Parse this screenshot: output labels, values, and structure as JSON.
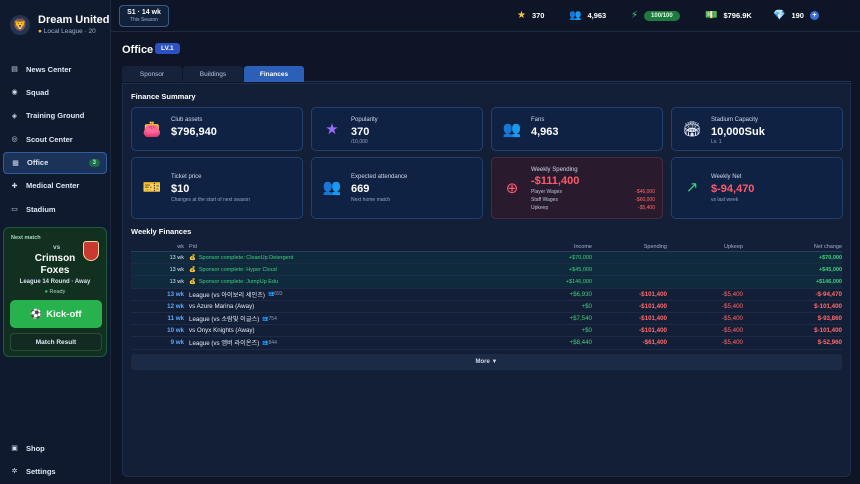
{
  "club": {
    "name": "Dream United",
    "league": "Local League · 20"
  },
  "season": {
    "label": "S1 · 14 wk",
    "sub": "This Season"
  },
  "stats": {
    "stars": "370",
    "fans": "4,963",
    "energy": "100/100",
    "money": "$796.9K",
    "gems": "190"
  },
  "nav": [
    {
      "label": "News Center",
      "icon": "newspaper-icon",
      "glyph": "▤"
    },
    {
      "label": "Squad",
      "icon": "squad-icon",
      "glyph": "◉"
    },
    {
      "label": "Training Ground",
      "icon": "training-icon",
      "glyph": "◈"
    },
    {
      "label": "Scout Center",
      "icon": "scout-icon",
      "glyph": "◎"
    },
    {
      "label": "Office",
      "icon": "office-icon",
      "glyph": "▦",
      "badge": "3"
    },
    {
      "label": "Medical Center",
      "icon": "medical-icon",
      "glyph": "✚"
    },
    {
      "label": "Stadium",
      "icon": "stadium-icon",
      "glyph": "▭"
    }
  ],
  "bottom_nav": [
    {
      "label": "Shop",
      "icon": "shop-icon",
      "glyph": "▣"
    },
    {
      "label": "Settings",
      "icon": "gear-icon",
      "glyph": "✲"
    }
  ],
  "next_match": {
    "label": "Next match",
    "vs": "vs",
    "opponent": "Crimson Foxes",
    "round": "League 14 Round · Away",
    "status": "Ready",
    "kickoff": "Kick-off",
    "result": "Match Result"
  },
  "page": {
    "title": "Office",
    "level": "LV.1"
  },
  "tabs": [
    "Sponsor",
    "Buildings",
    "Finances"
  ],
  "summary": {
    "title": "Finance Summary",
    "club_assets": {
      "label": "Club assets",
      "value": "$796,940"
    },
    "popularity": {
      "label": "Popularity",
      "value": "370",
      "sub": "/10,000"
    },
    "fans": {
      "label": "Fans",
      "value": "4,963"
    },
    "stadium": {
      "label": "Stadium Capacity",
      "value": "10,000Suk",
      "sub": "Lv. 1"
    },
    "ticket": {
      "label": "Ticket price",
      "value": "$10",
      "sub": "Changes at the start of next season"
    },
    "attendance": {
      "label": "Expected attendance",
      "value": "669",
      "sub": "Next home match"
    },
    "spending": {
      "label": "Weekly Spending",
      "value": "-$111,400",
      "rows": [
        {
          "label": "Player Wages",
          "value": "-$46,000"
        },
        {
          "label": "Staff Wages",
          "value": "-$60,000"
        },
        {
          "label": "Upkeep",
          "value": "-$5,400"
        }
      ]
    },
    "net": {
      "label": "Weekly Net",
      "value": "$-94,470",
      "sub": "vs last week"
    }
  },
  "weekly": {
    "title": "Weekly Finances",
    "headers": {
      "wk": "wk",
      "pid": "Pid",
      "income": "Income",
      "spending": "Spending",
      "upkeep": "Upkeep",
      "net": "Net change"
    },
    "rows": [
      {
        "wk": "13 wk",
        "pid": "Sponsor complete: CleanUp Detergent",
        "att": "",
        "income": "+$70,000",
        "spending": "",
        "upkeep": "",
        "net": "+$70,000",
        "type": "sp"
      },
      {
        "wk": "13 wk",
        "pid": "Sponsor complete: Hyper Cloud",
        "att": "",
        "income": "+$45,000",
        "spending": "",
        "upkeep": "",
        "net": "+$45,000",
        "type": "sp"
      },
      {
        "wk": "13 wk",
        "pid": "Sponsor complete: JumpUp Edu",
        "att": "",
        "income": "+$146,000",
        "spending": "",
        "upkeep": "",
        "net": "+$146,000",
        "type": "sp"
      },
      {
        "wk": "13 wk",
        "pid": "League (vs 아이보리 세인츠)",
        "att": "693",
        "income": "+$6,930",
        "spending": "-$101,400",
        "upkeep": "-$5,400",
        "net": "-$-94,470",
        "type": "lg"
      },
      {
        "wk": "12 wk",
        "pid": "vs Azure Marina (Away)",
        "att": "",
        "income": "+$0",
        "spending": "-$101,400",
        "upkeep": "-$5,400",
        "net": "$-101,400",
        "type": "lg"
      },
      {
        "wk": "11 wk",
        "pid": "League (vs 소람빛 이글스)",
        "att": "754",
        "income": "+$7,540",
        "spending": "-$101,400",
        "upkeep": "-$5,400",
        "net": "$-93,860",
        "type": "lg"
      },
      {
        "wk": "10 wk",
        "pid": "vs Onyx Knights (Away)",
        "att": "",
        "income": "+$0",
        "spending": "-$101,400",
        "upkeep": "-$5,400",
        "net": "$-101,400",
        "type": "lg"
      },
      {
        "wk": "9 wk",
        "pid": "League (vs 엠버 라이온즈)",
        "att": "844",
        "income": "+$8,440",
        "spending": "-$61,400",
        "upkeep": "-$5,400",
        "net": "$-52,960",
        "type": "lg"
      }
    ],
    "more": "More ▼"
  }
}
